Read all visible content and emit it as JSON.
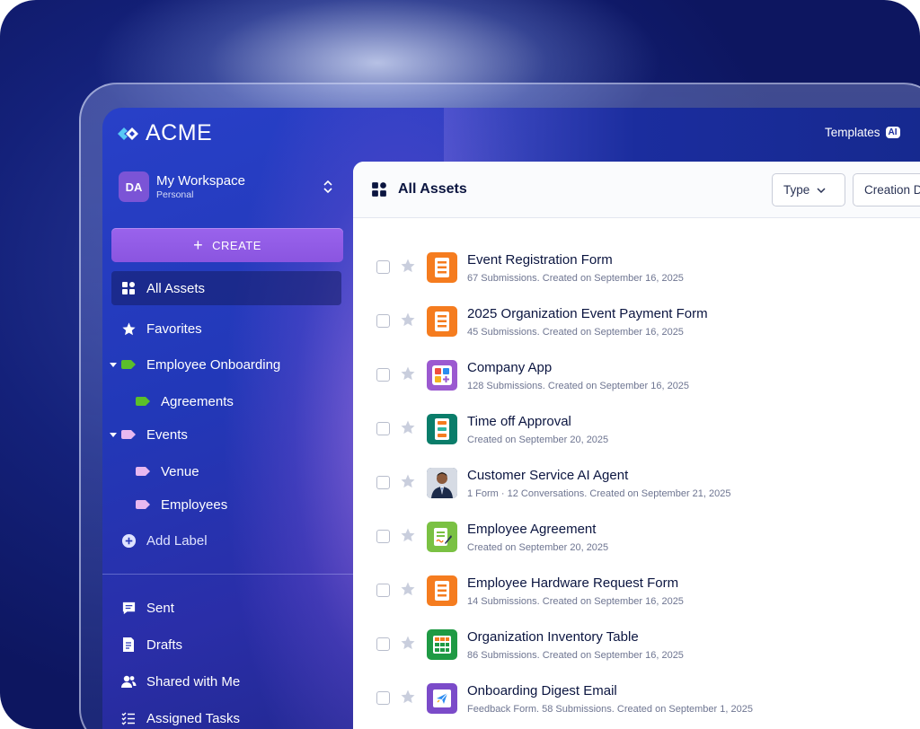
{
  "brand": {
    "name": "ACME"
  },
  "header": {
    "templates_label": "Templates",
    "ai_badge": "AI"
  },
  "workspace": {
    "initials": "DA",
    "title": "My Workspace",
    "subtitle": "Personal"
  },
  "sidebar": {
    "create_label": "CREATE",
    "items": [
      {
        "label": "All Assets",
        "icon": "grid-shapes-icon"
      },
      {
        "label": "Favorites",
        "icon": "star-icon"
      },
      {
        "label": "Employee Onboarding",
        "icon": "label-tag-icon",
        "color": "#5bbf2a"
      },
      {
        "label": "Agreements",
        "icon": "label-tag-icon",
        "color": "#5bbf2a"
      },
      {
        "label": "Events",
        "icon": "label-tag-icon",
        "color": "#e8b8f0"
      },
      {
        "label": "Venue",
        "icon": "label-tag-icon",
        "color": "#e8b8f0"
      },
      {
        "label": "Employees",
        "icon": "label-tag-icon",
        "color": "#e8b8f0"
      },
      {
        "label": "Add Label",
        "icon": "plus-circle-icon"
      },
      {
        "label": "Sent",
        "icon": "chat-bubble-icon"
      },
      {
        "label": "Drafts",
        "icon": "draft-doc-icon"
      },
      {
        "label": "Shared with Me",
        "icon": "users-icon"
      },
      {
        "label": "Assigned Tasks",
        "icon": "task-list-icon"
      }
    ]
  },
  "main": {
    "title": "All Assets",
    "filters": {
      "type_label": "Type",
      "creation_label": "Creation D"
    },
    "assets": [
      {
        "title": "Event Registration Form",
        "meta": "67 Submissions. Created on September 16, 2025",
        "icon": "form-icon",
        "color": "#f57c1f"
      },
      {
        "title": "2025 Organization Event Payment Form",
        "meta": "45 Submissions. Created on September 16, 2025",
        "icon": "form-icon",
        "color": "#f57c1f"
      },
      {
        "title": "Company App",
        "meta": "128 Submissions. Created on September 16, 2025",
        "icon": "app-icon",
        "color": "#9b59d0"
      },
      {
        "title": "Time off Approval",
        "meta": "Created on September 20, 2025",
        "icon": "approval-flow-icon",
        "color": "#0a7d6a"
      },
      {
        "title": "Customer Service AI Agent",
        "meta": "1 Form · 12 Conversations. Created on September 21, 2025",
        "icon": "agent-avatar-icon",
        "color": "#2a4a7a"
      },
      {
        "title": "Employee Agreement",
        "meta": "Created on September 20, 2025",
        "icon": "sign-document-icon",
        "color": "#7ac143"
      },
      {
        "title": "Employee Hardware Request Form",
        "meta": "14 Submissions. Created on September 16, 2025",
        "icon": "form-icon",
        "color": "#f57c1f"
      },
      {
        "title": "Organization Inventory Table",
        "meta": "86 Submissions. Created on September 16, 2025",
        "icon": "table-icon",
        "color": "#1f9a44"
      },
      {
        "title": "Onboarding Digest Email",
        "meta": "Feedback Form. 58 Submissions. Created on September 1, 2025",
        "icon": "email-send-icon",
        "color": "#7b4bc9"
      }
    ]
  }
}
